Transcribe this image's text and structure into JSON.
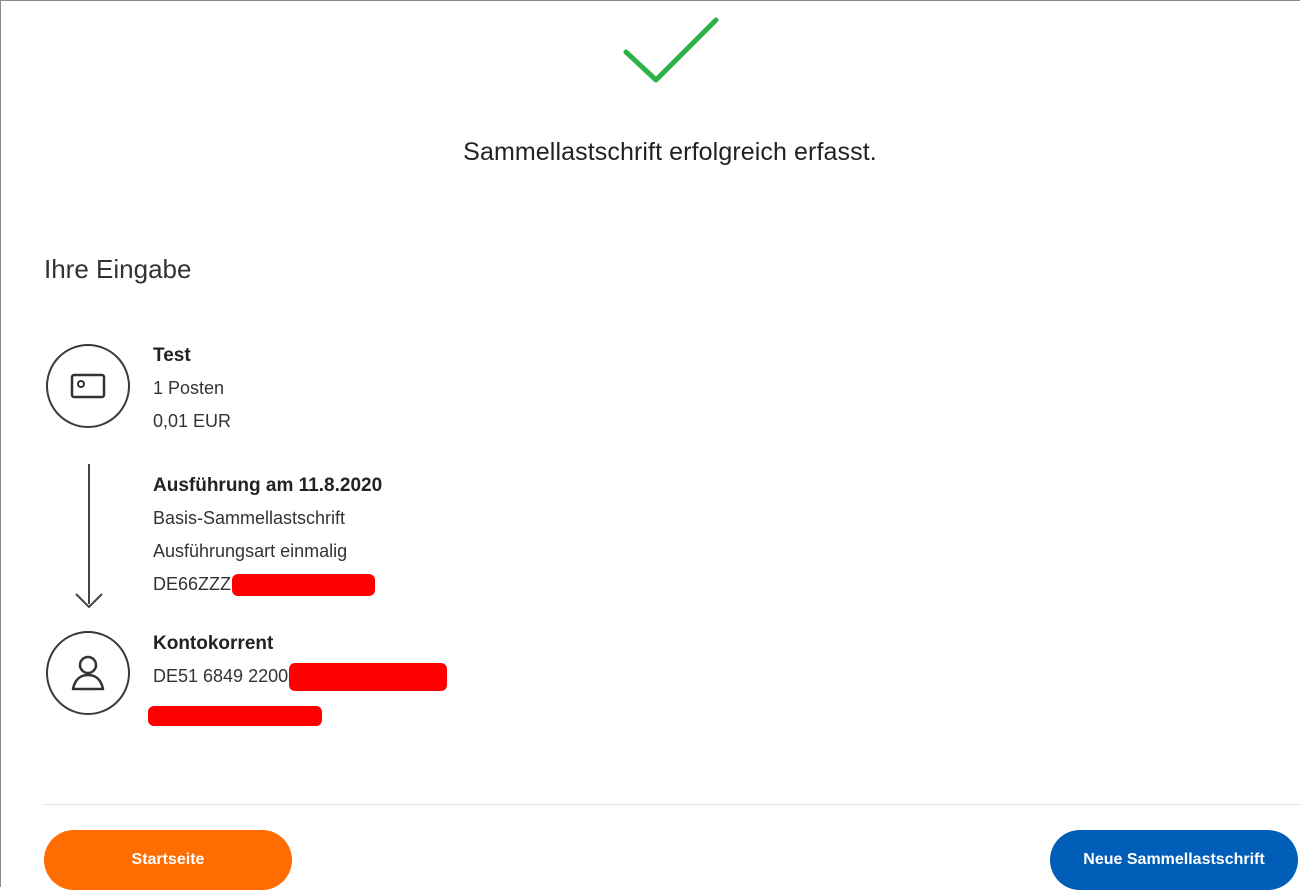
{
  "success": {
    "title": "Sammellastschrift erfolgreich erfasst.",
    "icon": "checkmark-icon",
    "color": "#2db24a"
  },
  "section": {
    "title": "Ihre Eingabe"
  },
  "order": {
    "icon": "card-icon",
    "name": "Test",
    "items": "1 Posten",
    "amount": "0,01 EUR"
  },
  "execution": {
    "icon": "arrow-down-icon",
    "title": "Ausführung am 11.8.2020",
    "type": "Basis-Sammellastschrift",
    "mode": "Ausführungsart einmalig",
    "creditor_id": "DE66ZZZ"
  },
  "account": {
    "icon": "user-icon",
    "name": "Kontokorrent",
    "iban": "DE51 6849 2200"
  },
  "buttons": {
    "home_label": "Startseite",
    "new_label": "Neue Sammellastschrift"
  },
  "colors": {
    "primary_button": "#ff6d00",
    "secondary_button": "#005eb8",
    "redaction": "#ff0000"
  }
}
